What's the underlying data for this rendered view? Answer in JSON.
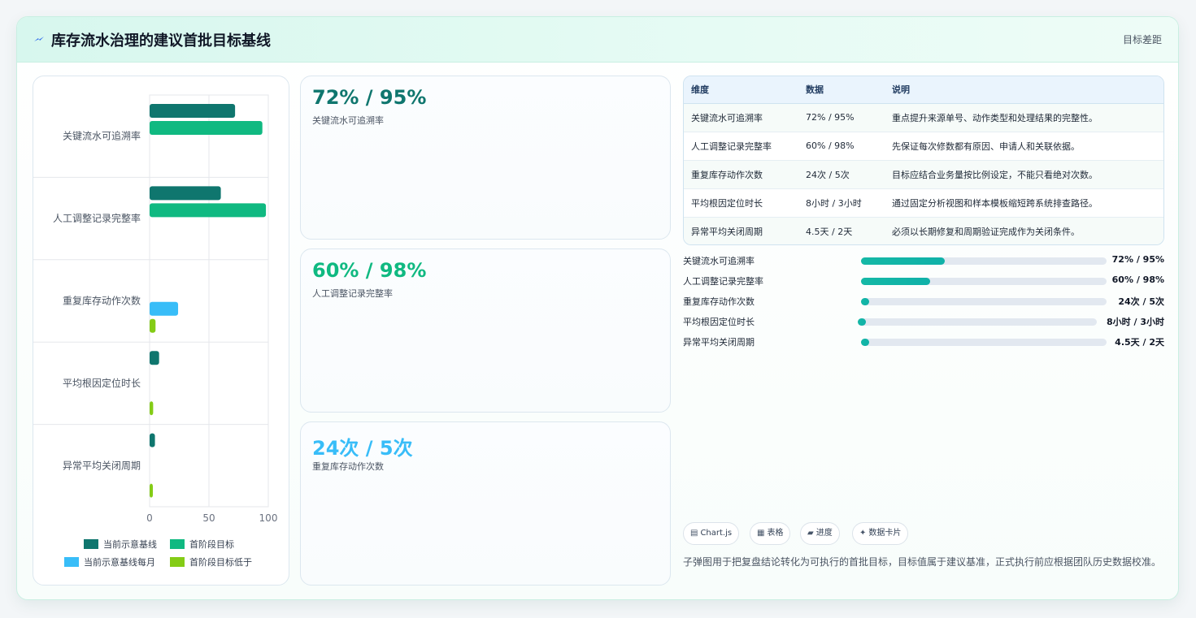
{
  "header": {
    "icon": "lightning-icon",
    "title": "库存流水治理的建议首批目标基线",
    "link": "目标差距"
  },
  "kpis": [
    {
      "value": "72% / 95%",
      "label": "关键流水可追溯率",
      "color": "#0f766e"
    },
    {
      "value": "60% / 98%",
      "label": "人工调整记录完整率",
      "color": "#10b981"
    },
    {
      "value": "24次 / 5次",
      "label": "重复库存动作次数",
      "color": "#38bdf8"
    }
  ],
  "table": {
    "headers": [
      "维度",
      "数据",
      "说明"
    ],
    "rows": [
      [
        "关键流水可追溯率",
        "72% / 95%",
        "重点提升来源单号、动作类型和处理结果的完整性。"
      ],
      [
        "人工调整记录完整率",
        "60% / 98%",
        "先保证每次修数都有原因、申请人和关联依据。"
      ],
      [
        "重复库存动作次数",
        "24次 / 5次",
        "目标应结合业务量按比例设定，不能只看绝对次数。"
      ],
      [
        "平均根因定位时长",
        "8小时 / 3小时",
        "通过固定分析视图和样本模板缩短跨系统排查路径。"
      ],
      [
        "异常平均关闭周期",
        "4.5天 / 2天",
        "必须以长期修复和周期验证完成作为关闭条件。"
      ]
    ]
  },
  "progress": [
    {
      "label": "关键流水可追溯率",
      "value": "72% / 95%",
      "ratio": 0.34
    },
    {
      "label": "人工调整记录完整率",
      "value": "60% / 98%",
      "ratio": 0.28
    },
    {
      "label": "重复库存动作次数",
      "value": "24次 / 5次",
      "ratio": 0.0
    },
    {
      "label": "平均根因定位时长",
      "value": "8小时 / 3小时",
      "ratio": 0.0
    },
    {
      "label": "异常平均关闭周期",
      "value": "4.5天 / 2天",
      "ratio": 0.0
    }
  ],
  "tags": [
    {
      "icon": "chart-icon",
      "glyph": "▤",
      "label": "Chart.js"
    },
    {
      "icon": "table-icon",
      "glyph": "▦",
      "label": "表格"
    },
    {
      "icon": "progress-icon",
      "glyph": "▰",
      "label": "进度"
    },
    {
      "icon": "sparkle-icon",
      "glyph": "✦",
      "label": "数据卡片"
    }
  ],
  "note": "子弹图用于把复盘结论转化为可执行的首批目标，目标值属于建议基准，正式执行前应根据团队历史数据校准。",
  "chart_data": {
    "type": "bar",
    "orientation": "horizontal",
    "categories": [
      "关键流水可追溯率",
      "人工调整记录完整率",
      "重复库存动作次数",
      "平均根因定位时长",
      "异常平均关闭周期"
    ],
    "series": [
      {
        "name": "当前示意基线",
        "color": "#0f766e",
        "values": [
          72,
          60,
          null,
          8,
          4.5
        ]
      },
      {
        "name": "首阶段目标",
        "color": "#10b981",
        "values": [
          95,
          98,
          null,
          null,
          null
        ]
      },
      {
        "name": "当前示意基线每月",
        "color": "#38bdf8",
        "values": [
          null,
          null,
          24,
          null,
          null
        ]
      },
      {
        "name": "首阶段目标低于",
        "color": "#84cc16",
        "values": [
          null,
          null,
          5,
          3,
          2
        ]
      }
    ],
    "x_ticks": [
      "0",
      "50",
      "100"
    ],
    "xlim": [
      0,
      100
    ],
    "grid": true,
    "legend": "bottom"
  }
}
